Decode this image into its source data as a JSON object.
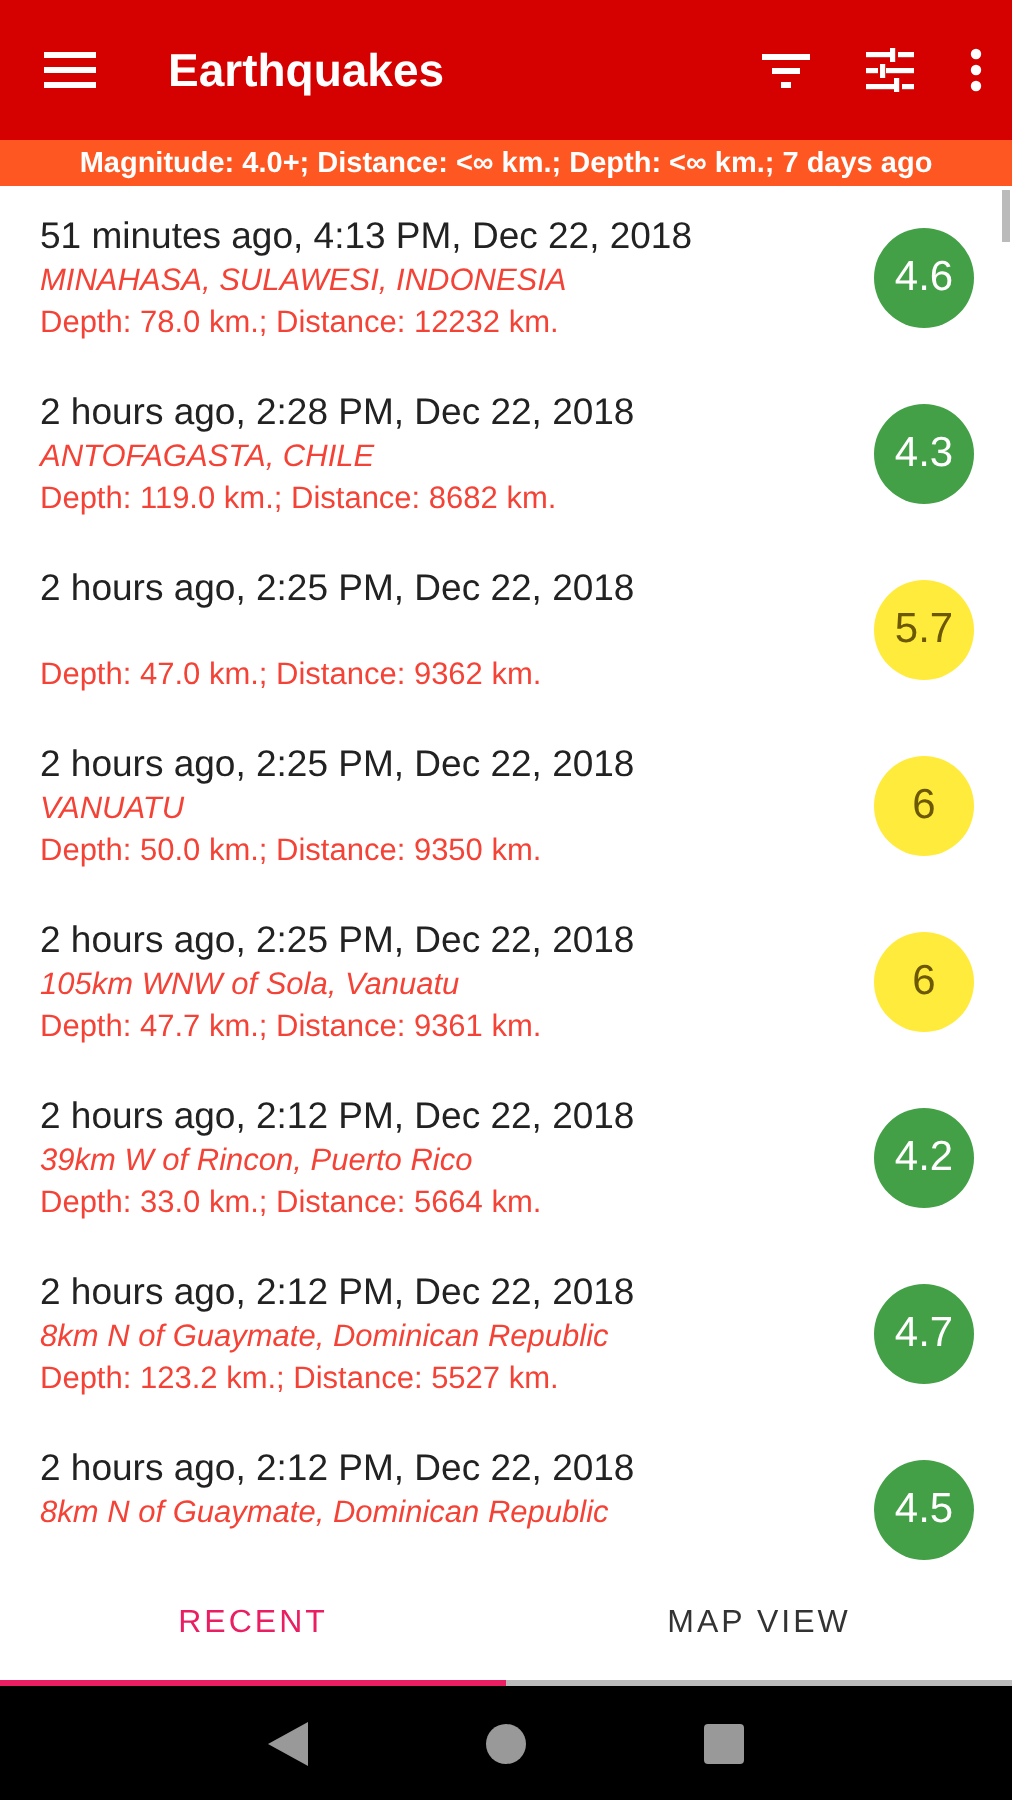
{
  "app_bar": {
    "title": "Earthquakes"
  },
  "filter_summary": "Magnitude: 4.0+; Distance: <∞ km.; Depth: <∞ km.; 7 days ago",
  "quakes": [
    {
      "time": "51 minutes ago, 4:13 PM, Dec 22, 2018",
      "location": "MINAHASA, SULAWESI, INDONESIA",
      "details": "Depth: 78.0 km.; Distance: 12232 km.",
      "magnitude": "4.6",
      "color": "#43a047"
    },
    {
      "time": "2 hours ago, 2:28 PM, Dec 22, 2018",
      "location": "ANTOFAGASTA, CHILE",
      "details": "Depth: 119.0 km.; Distance: 8682 km.",
      "magnitude": "4.3",
      "color": "#43a047"
    },
    {
      "time": "2 hours ago, 2:25 PM, Dec 22, 2018",
      "details": "Depth: 47.0 km.; Distance: 9362 km.",
      "magnitude": "5.7",
      "color": "#ffeb3b"
    },
    {
      "time": "2 hours ago, 2:25 PM, Dec 22, 2018",
      "location": "VANUATU",
      "details": "Depth: 50.0 km.; Distance: 9350 km.",
      "magnitude": "6",
      "color": "#ffeb3b"
    },
    {
      "time": "2 hours ago, 2:25 PM, Dec 22, 2018",
      "location": "105km WNW of Sola, Vanuatu",
      "details": "Depth: 47.7 km.; Distance: 9361 km.",
      "magnitude": "6",
      "color": "#ffeb3b"
    },
    {
      "time": "2 hours ago, 2:12 PM, Dec 22, 2018",
      "location": "39km W of Rincon, Puerto Rico",
      "details": "Depth: 33.0 km.; Distance: 5664 km.",
      "magnitude": "4.2",
      "color": "#43a047"
    },
    {
      "time": "2 hours ago, 2:12 PM, Dec 22, 2018",
      "location": "8km N of Guaymate, Dominican Republic",
      "details": "Depth: 123.2 km.; Distance: 5527 km.",
      "magnitude": "4.7",
      "color": "#43a047"
    },
    {
      "time": "2 hours ago, 2:12 PM, Dec 22, 2018",
      "location": "8km N of Guaymate, Dominican Republic",
      "magnitude": "4.5",
      "color": "#43a047"
    }
  ],
  "tabs": [
    {
      "label": "RECENT",
      "selected": true
    },
    {
      "label": "MAP VIEW",
      "selected": false
    }
  ]
}
